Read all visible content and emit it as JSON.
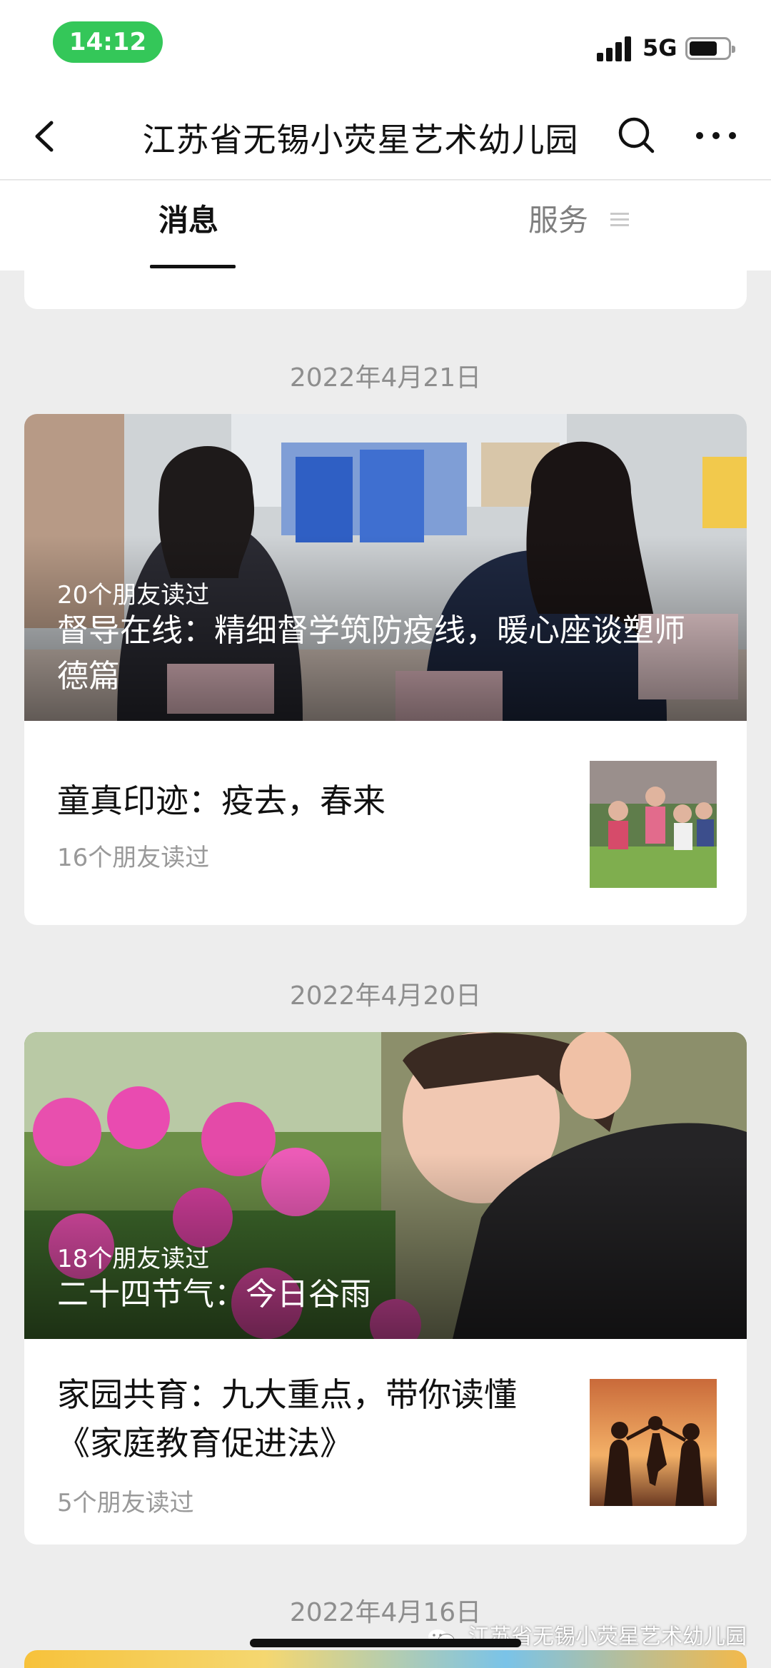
{
  "status_bar": {
    "time": "14:12",
    "network": "5G"
  },
  "nav": {
    "title": "江苏省无锡小荧星艺术幼儿园"
  },
  "tabs": {
    "messages": "消息",
    "services": "服务"
  },
  "feed": [
    {
      "date": "2022年4月21日",
      "hero": {
        "reads": "20个朋友读过",
        "title": "督导在线：精细督学筑防疫线，暖心座谈塑师德篇"
      },
      "article": {
        "title": "童真印迹：疫去，春来",
        "reads": "16个朋友读过"
      }
    },
    {
      "date": "2022年4月20日",
      "hero": {
        "reads": "18个朋友读过",
        "title": "二十四节气：今日谷雨"
      },
      "article": {
        "title": "家园共育：九大重点，带你读懂《家庭教育促进法》",
        "reads": "5个朋友读过"
      }
    },
    {
      "date": "2022年4月16日"
    }
  ],
  "watermark": "江苏省无锡小荧星艺术幼儿园",
  "icons": {
    "back": "chevron-left-icon",
    "search": "search-icon",
    "more": "more-dots-icon",
    "services_menu": "menu-lines-icon",
    "watermark": "wechat-logo-icon"
  },
  "colors": {
    "time_pill": "#34c759",
    "background": "#ededed",
    "meta_text": "#999999"
  }
}
